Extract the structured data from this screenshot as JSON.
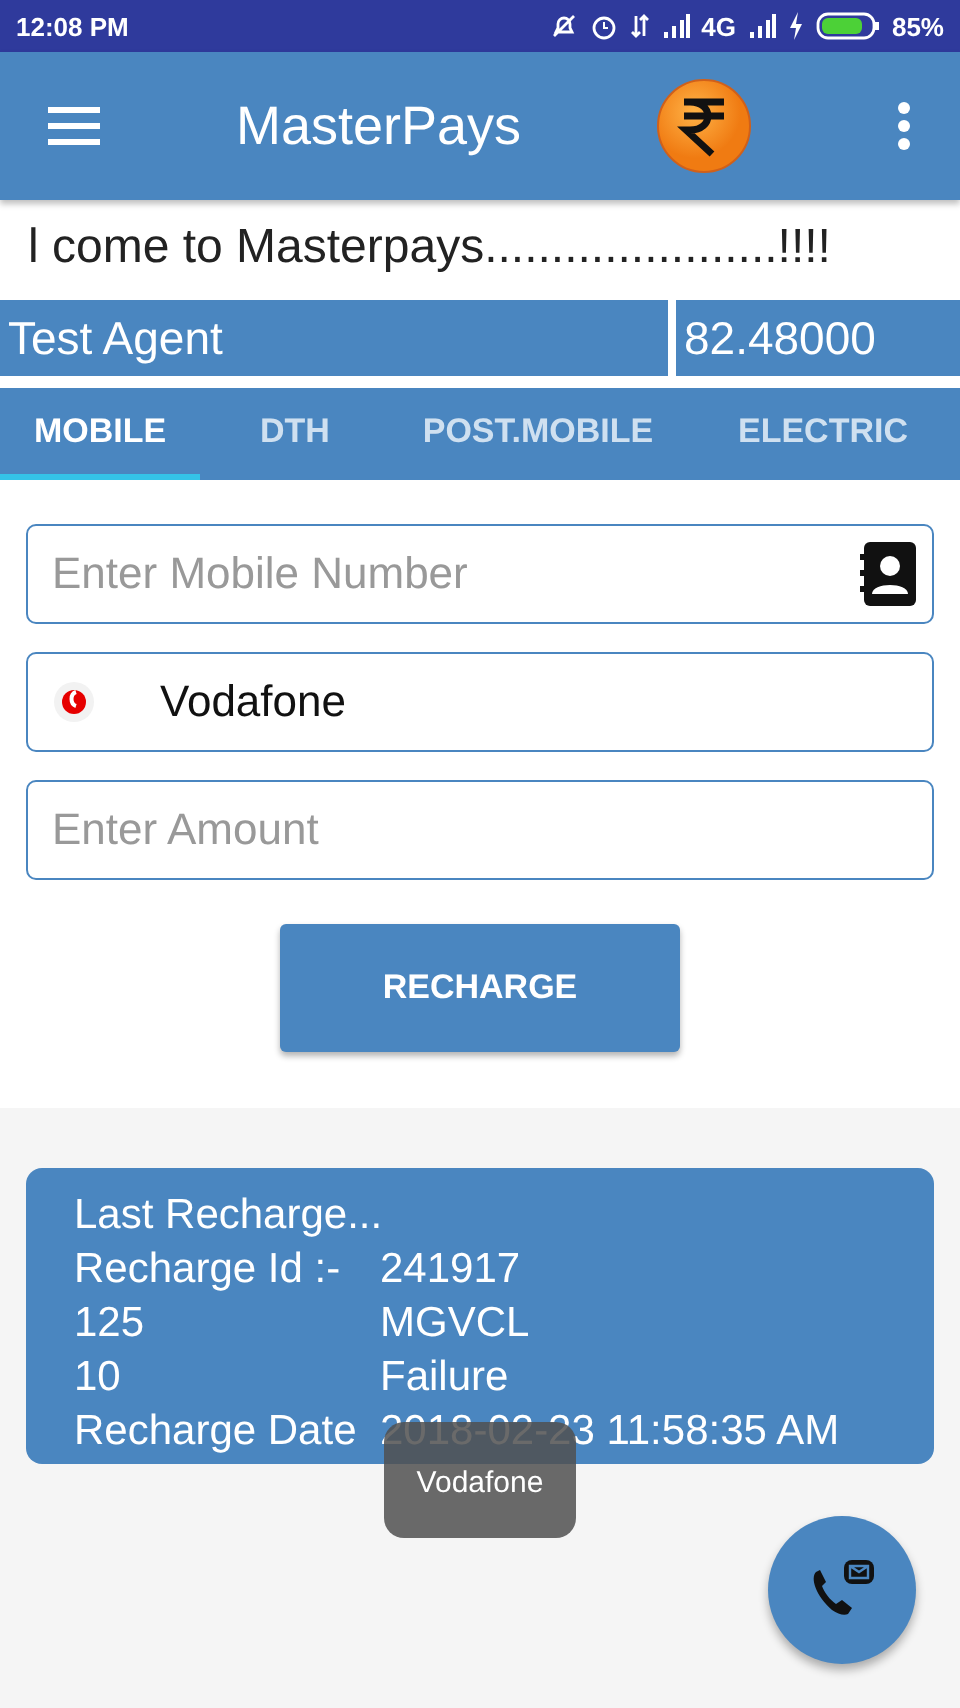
{
  "status_bar": {
    "time": "12:08 PM",
    "network": "4G",
    "battery": "85%"
  },
  "app_bar": {
    "title": "MasterPays"
  },
  "ticker": "l come to Masterpays......................!!!!",
  "agent": {
    "name": "Test Agent",
    "balance": "82.48000"
  },
  "tabs": [
    {
      "label": "MOBILE",
      "selected": true
    },
    {
      "label": "DTH",
      "selected": false
    },
    {
      "label": "POST.MOBILE",
      "selected": false
    },
    {
      "label": "ELECTRIC",
      "selected": false
    }
  ],
  "form": {
    "mobile": {
      "placeholder": "Enter Mobile Number"
    },
    "operator": {
      "value": "Vodafone"
    },
    "amount": {
      "placeholder": "Enter Amount"
    },
    "button": "RECHARGE"
  },
  "last_recharge": {
    "title": "Last Recharge...",
    "rows": [
      {
        "label": "Recharge Id :-",
        "value": "241917"
      },
      {
        "label": "125",
        "value": "MGVCL"
      },
      {
        "label": "10",
        "value": "Failure"
      },
      {
        "label": "Recharge Date",
        "value": "2018-02-23 11:58:35 AM"
      }
    ]
  },
  "toast": "Vodafone"
}
